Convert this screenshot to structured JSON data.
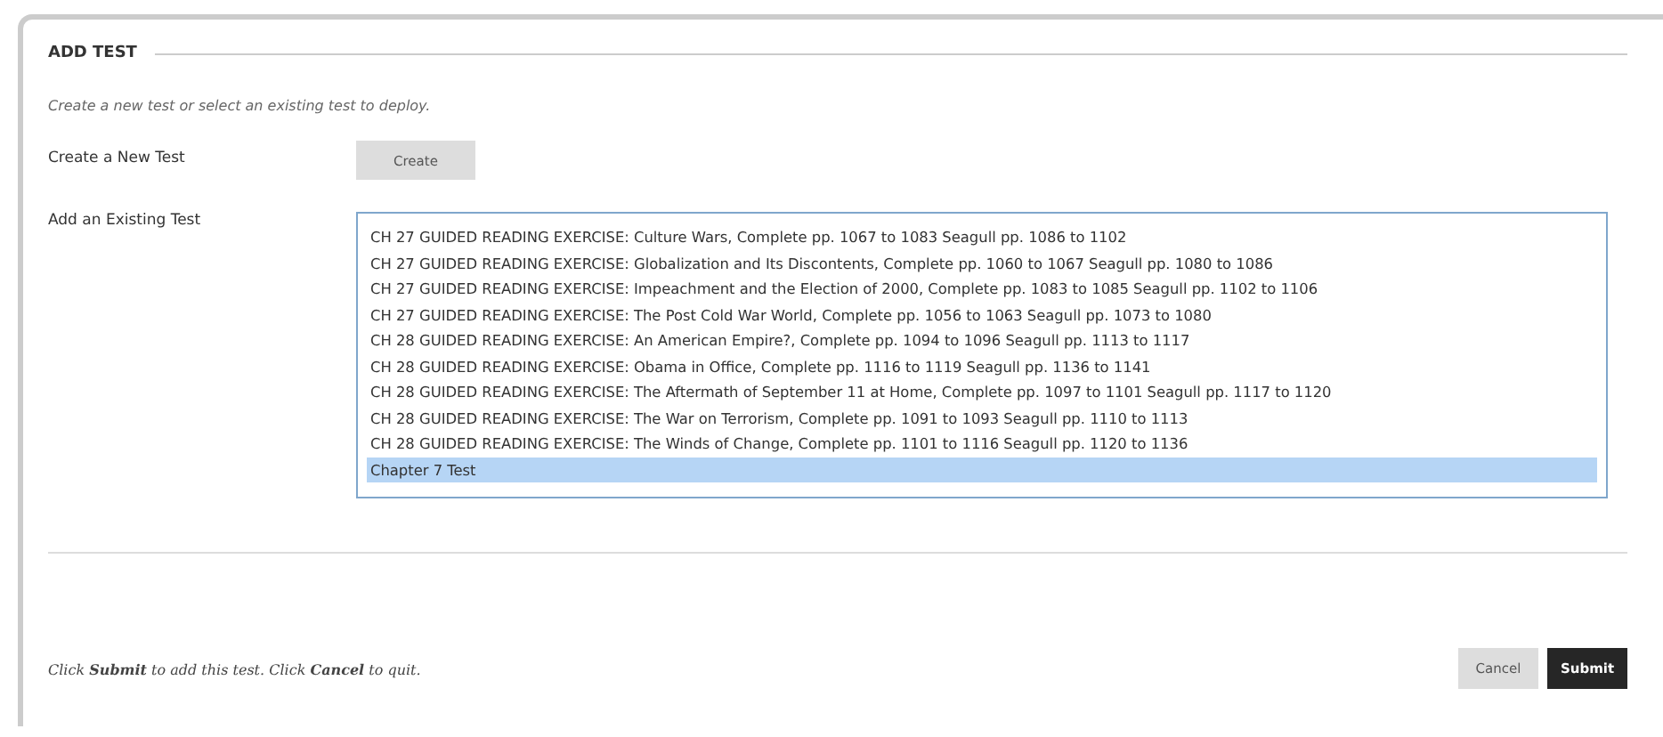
{
  "section": {
    "title": "ADD TEST"
  },
  "instructions": "Create a new test or select an existing test to deploy.",
  "create": {
    "label": "Create a New Test",
    "button": "Create"
  },
  "existing": {
    "label": "Add an Existing Test",
    "options": [
      {
        "text": "CH 27 GUIDED READING EXERCISE: Culture Wars, Complete pp. 1067 to 1083 Seagull pp. 1086 to 1102",
        "selected": false
      },
      {
        "text": "CH 27 GUIDED READING EXERCISE: Globalization and Its Discontents, Complete pp. 1060 to 1067 Seagull pp. 1080 to 1086",
        "selected": false
      },
      {
        "text": "CH 27 GUIDED READING EXERCISE: Impeachment and the Election of 2000, Complete pp. 1083 to 1085 Seagull pp. 1102 to 1106",
        "selected": false
      },
      {
        "text": "CH 27 GUIDED READING EXERCISE: The Post Cold War World, Complete pp. 1056 to 1063 Seagull pp. 1073 to 1080",
        "selected": false
      },
      {
        "text": "CH 28 GUIDED READING EXERCISE: An American Empire?, Complete pp. 1094 to 1096 Seagull pp. 1113 to 1117",
        "selected": false
      },
      {
        "text": "CH 28 GUIDED READING EXERCISE: Obama in Office, Complete pp. 1116 to 1119 Seagull pp. 1136 to 1141",
        "selected": false
      },
      {
        "text": "CH 28 GUIDED READING EXERCISE: The Aftermath of September 11 at Home, Complete pp. 1097 to 1101 Seagull pp. 1117 to 1120",
        "selected": false
      },
      {
        "text": "CH 28 GUIDED READING EXERCISE: The War on Terrorism, Complete pp. 1091 to 1093 Seagull pp. 1110 to 1113",
        "selected": false
      },
      {
        "text": "CH 28 GUIDED READING EXERCISE: The Winds of Change, Complete pp. 1101 to 1116 Seagull pp. 1120 to 1136",
        "selected": false
      },
      {
        "text": "Chapter 7 Test",
        "selected": true
      }
    ]
  },
  "footer": {
    "note": "Click **Submit** to add this test. Click **Cancel** to quit.",
    "buttons": [
      {
        "label": "Cancel",
        "kind": "secondary"
      },
      {
        "label": "Submit",
        "kind": "primary"
      }
    ]
  }
}
